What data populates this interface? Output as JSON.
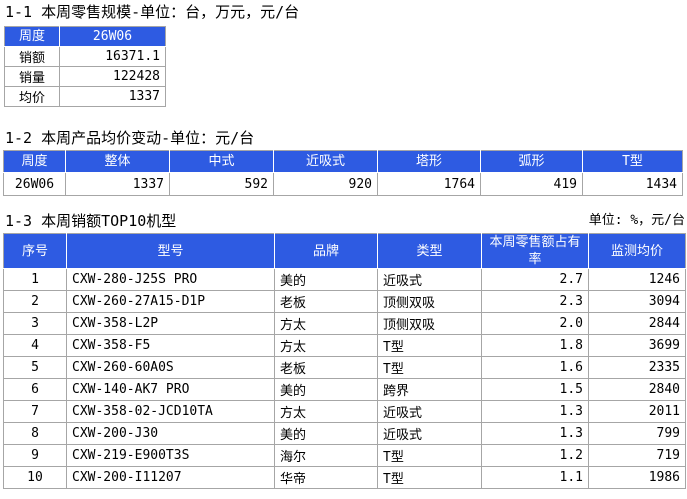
{
  "colors": {
    "header_blue": "#2e5be2",
    "border_gray": "#a6a6a6",
    "header_text": "#ffffff",
    "body_text": "#000000"
  },
  "section_retail_scale": {
    "title": "1-1 本周零售规模-单位：台，万元，元/台",
    "table": {
      "headers": [
        "周度",
        "26W06"
      ],
      "rows": [
        [
          "销额",
          "16371.1"
        ],
        [
          "销量",
          "122428"
        ],
        [
          "均价",
          "1337"
        ]
      ]
    }
  },
  "section_avg_price": {
    "title": "1-2 本周产品均价变动-单位：元/台",
    "table": {
      "headers": [
        "周度",
        "整体",
        "中式",
        "近吸式",
        "塔形",
        "弧形",
        "T型"
      ],
      "rows": [
        [
          "26W06",
          "1337",
          "592",
          "920",
          "1764",
          "419",
          "1434"
        ]
      ]
    }
  },
  "section_top10": {
    "title": "1-3 本周销额TOP10机型",
    "unit_label": "单位: %，元/台",
    "table": {
      "headers": [
        "序号",
        "型号",
        "品牌",
        "类型",
        "本周零售额占有率",
        "监测均价"
      ],
      "rows": [
        [
          "1",
          "CXW-280-J25S PRO",
          "美的",
          "近吸式",
          "2.7",
          "1246"
        ],
        [
          "2",
          "CXW-260-27A15-D1P",
          "老板",
          "顶侧双吸",
          "2.3",
          "3094"
        ],
        [
          "3",
          "CXW-358-L2P",
          "方太",
          "顶侧双吸",
          "2.0",
          "2844"
        ],
        [
          "4",
          "CXW-358-F5",
          "方太",
          "T型",
          "1.8",
          "3699"
        ],
        [
          "5",
          "CXW-260-60A0S",
          "老板",
          "T型",
          "1.6",
          "2335"
        ],
        [
          "6",
          "CXW-140-AK7 PRO",
          "美的",
          "跨界",
          "1.5",
          "2840"
        ],
        [
          "7",
          "CXW-358-02-JCD10TA",
          "方太",
          "近吸式",
          "1.3",
          "2011"
        ],
        [
          "8",
          "CXW-200-J30",
          "美的",
          "近吸式",
          "1.3",
          "799"
        ],
        [
          "9",
          "CXW-219-E900T3S",
          "海尔",
          "T型",
          "1.2",
          "719"
        ],
        [
          "10",
          "CXW-200-I11207",
          "华帝",
          "T型",
          "1.1",
          "1986"
        ]
      ]
    }
  }
}
